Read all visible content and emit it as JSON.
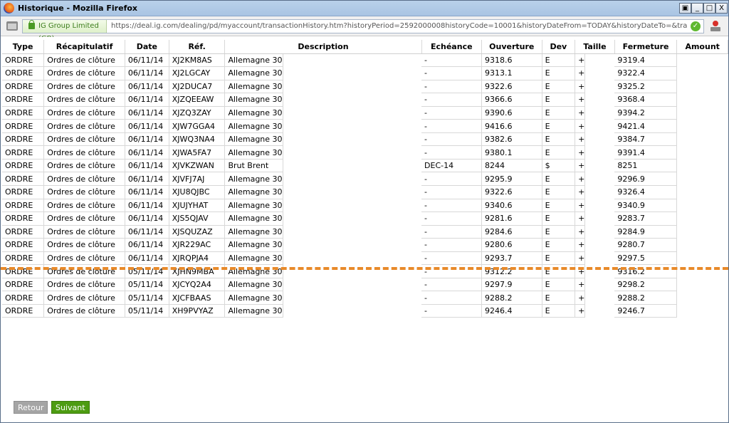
{
  "window": {
    "title": "Historique - Mozilla Firefox",
    "controls": [
      "▣",
      "_",
      "□",
      "X"
    ]
  },
  "navbar": {
    "identity": "IG Group Limited (GB)",
    "url": "https://deal.ig.com/dealing/pd/myaccount/transactionHistory.htm?historyPeriod=2592000008historyCode=10001&historyDateFrom=TODAY&historyDateTo=&transactionHistoryPageNumbe",
    "go_glyph": "✓"
  },
  "table": {
    "headers": [
      "Type",
      "Récapitulatif",
      "Date",
      "Réf.",
      "Description",
      "Echéance",
      "Ouverture",
      "Dev",
      "Taille",
      "Fermeture",
      "Amount"
    ],
    "rows": [
      [
        "ORDRE",
        "Ordres de clôture",
        "06/11/14",
        "XJ2KM8AS",
        "Allemagne 30",
        "-",
        "9318.6",
        "E",
        "+",
        "9319.4"
      ],
      [
        "ORDRE",
        "Ordres de clôture",
        "06/11/14",
        "XJ2LGCAY",
        "Allemagne 30",
        "-",
        "9313.1",
        "E",
        "+",
        "9322.4"
      ],
      [
        "ORDRE",
        "Ordres de clôture",
        "06/11/14",
        "XJ2DUCA7",
        "Allemagne 30",
        "-",
        "9322.6",
        "E",
        "+",
        "9325.2"
      ],
      [
        "ORDRE",
        "Ordres de clôture",
        "06/11/14",
        "XJZQEEAW",
        "Allemagne 30",
        "-",
        "9366.6",
        "E",
        "+",
        "9368.4"
      ],
      [
        "ORDRE",
        "Ordres de clôture",
        "06/11/14",
        "XJZQ3ZAY",
        "Allemagne 30",
        "-",
        "9390.6",
        "E",
        "+",
        "9394.2"
      ],
      [
        "ORDRE",
        "Ordres de clôture",
        "06/11/14",
        "XJW7GGA4",
        "Allemagne 30",
        "-",
        "9416.6",
        "E",
        "+",
        "9421.4"
      ],
      [
        "ORDRE",
        "Ordres de clôture",
        "06/11/14",
        "XJWQ3NA4",
        "Allemagne 30",
        "-",
        "9382.6",
        "E",
        "+",
        "9384.7"
      ],
      [
        "ORDRE",
        "Ordres de clôture",
        "06/11/14",
        "XJWA5FA7",
        "Allemagne 30",
        "-",
        "9380.1",
        "E",
        "+",
        "9391.4"
      ],
      [
        "ORDRE",
        "Ordres de clôture",
        "06/11/14",
        "XJVKZWAN",
        "Brut Brent",
        "DEC-14",
        "8244",
        "$",
        "+",
        "8251"
      ],
      [
        "ORDRE",
        "Ordres de clôture",
        "06/11/14",
        "XJVFJ7AJ",
        "Allemagne 30",
        "-",
        "9295.9",
        "E",
        "+",
        "9296.9"
      ],
      [
        "ORDRE",
        "Ordres de clôture",
        "06/11/14",
        "XJU8QJBC",
        "Allemagne 30",
        "-",
        "9322.6",
        "E",
        "+",
        "9326.4"
      ],
      [
        "ORDRE",
        "Ordres de clôture",
        "06/11/14",
        "XJUJYHAT",
        "Allemagne 30",
        "-",
        "9340.6",
        "E",
        "+",
        "9340.9"
      ],
      [
        "ORDRE",
        "Ordres de clôture",
        "06/11/14",
        "XJS5QJAV",
        "Allemagne 30",
        "-",
        "9281.6",
        "E",
        "+",
        "9283.7"
      ],
      [
        "ORDRE",
        "Ordres de clôture",
        "06/11/14",
        "XJSQUZAZ",
        "Allemagne 30",
        "-",
        "9284.6",
        "E",
        "+",
        "9284.9"
      ],
      [
        "ORDRE",
        "Ordres de clôture",
        "06/11/14",
        "XJR229AC",
        "Allemagne 30",
        "-",
        "9280.6",
        "E",
        "+",
        "9280.7"
      ],
      [
        "ORDRE",
        "Ordres de clôture",
        "06/11/14",
        "XJRQPJA4",
        "Allemagne 30",
        "-",
        "9293.7",
        "E",
        "+",
        "9297.5"
      ],
      [
        "ORDRE",
        "Ordres de clôture",
        "05/11/14",
        "XJHN9MBA",
        "Allemagne 30",
        "-",
        "9312.2",
        "E",
        "+",
        "9316.2"
      ],
      [
        "ORDRE",
        "Ordres de clôture",
        "05/11/14",
        "XJCYQ2A4",
        "Allemagne 30",
        "-",
        "9297.9",
        "E",
        "+",
        "9298.2"
      ],
      [
        "ORDRE",
        "Ordres de clôture",
        "05/11/14",
        "XJCFBAAS",
        "Allemagne 30",
        "-",
        "9288.2",
        "E",
        "+",
        "9288.2"
      ],
      [
        "ORDRE",
        "Ordres de clôture",
        "05/11/14",
        "XH9PVYAZ",
        "Allemagne 30",
        "-",
        "9246.4",
        "E",
        "+",
        "9246.7"
      ]
    ]
  },
  "pager": {
    "prev_label": "Retour",
    "next_label": "Suivant"
  },
  "colors": {
    "cut_line": "#e88a2a",
    "next_button": "#4d9c12",
    "prev_button": "#a5a5a5",
    "secure_identity": "#3c7d1c"
  }
}
